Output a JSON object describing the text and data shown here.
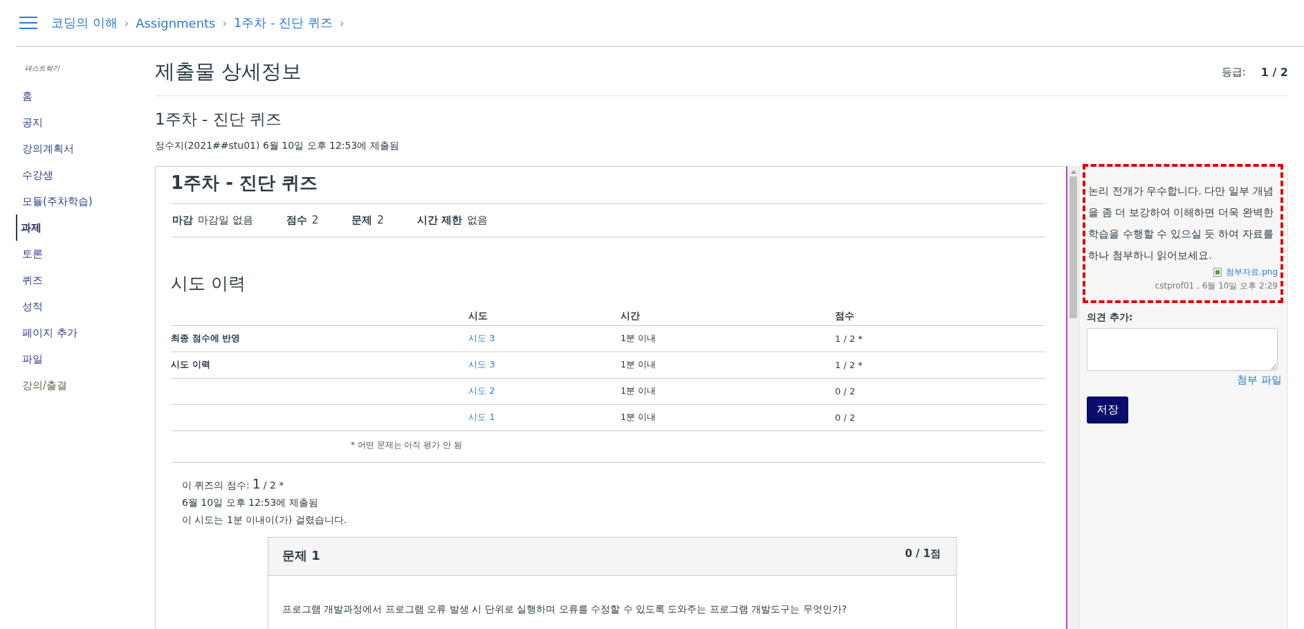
{
  "breadcrumb": {
    "separator": "›",
    "items": [
      "코딩의 이해",
      "Assignments",
      "1주차 - 진단 퀴즈"
    ]
  },
  "sidebar": {
    "term": "테스트학기",
    "items": [
      {
        "label": "홈",
        "selected": false,
        "kind": "course"
      },
      {
        "label": "공지",
        "selected": false,
        "kind": "course"
      },
      {
        "label": "강의계획서",
        "selected": false,
        "kind": "course"
      },
      {
        "label": "수강생",
        "selected": false,
        "kind": "course"
      },
      {
        "label": "모듈(주차학습)",
        "selected": false,
        "kind": "course"
      },
      {
        "label": "과제",
        "selected": true,
        "kind": "course"
      },
      {
        "label": "토론",
        "selected": false,
        "kind": "course"
      },
      {
        "label": "퀴즈",
        "selected": false,
        "kind": "course"
      },
      {
        "label": "성적",
        "selected": false,
        "kind": "course"
      },
      {
        "label": "페이지 추가",
        "selected": false,
        "kind": "course"
      },
      {
        "label": "파일",
        "selected": false,
        "kind": "course"
      },
      {
        "label": "강의/출결",
        "selected": false,
        "kind": "tool"
      }
    ]
  },
  "page": {
    "title": "제출물 상세정보",
    "grade": {
      "label": "등급:",
      "value": "1 / 2"
    },
    "subtitle": "1주차 - 진단 퀴즈",
    "submitted": "정수지(2021##stu01) 6월 10일 오후 12:53에 제출됨"
  },
  "quiz": {
    "title": "1주차 - 진단 퀴즈",
    "meta": [
      {
        "label": "마감",
        "value": "마감일 없음"
      },
      {
        "label": "점수",
        "value": "2"
      },
      {
        "label": "문제",
        "value": "2"
      },
      {
        "label": "시간 제한",
        "value": "없음"
      }
    ],
    "attempts": {
      "heading": "시도 이력",
      "columns": [
        "시도",
        "시간",
        "점수"
      ],
      "rows": [
        {
          "label": "최종 점수에 반영",
          "attempt": "시도 3",
          "time": "1분 이내",
          "score": "1 / 2 *"
        },
        {
          "label": "시도 이력",
          "attempt": "시도 3",
          "time": "1분 이내",
          "score": "1 / 2 *"
        },
        {
          "attempt": "시도 2",
          "time": "1분 이내",
          "score": "0 / 2"
        },
        {
          "attempt": "시도 1",
          "time": "1분 이내",
          "score": "0 / 2"
        }
      ],
      "footnote": "* 어떤 문제는 아직 평가 안 됨"
    },
    "summary": {
      "score_label": "이 퀴즈의 점수:",
      "score": "1",
      "score_rest": "/ 2 *",
      "submitted": "6월 10일 오후 12:53에 제출됨",
      "duration": "이 시도는 1분 이내이(가) 걸렸습니다."
    },
    "question": {
      "title": "문제 1",
      "points": "0 / 1점",
      "text": "프로그램 개발과정에서 프로그램 오류 발생 시 단위로 실행하며 오류를 수정할 수 있도록 도와주는 프로그램 개발도구는 무엇인가?"
    }
  },
  "comments": [
    {
      "text": "논리 전개가 우수합니다. 다만 일부 개념을 좀 더 보강하여 이해하면 더욱 완벽한 학습을 수행할 수 있으실 듯 하여 자료를 하나 첨부하니 읽어보세요.",
      "attachment": "첨부자료.png",
      "author": "cstprof01 , 6월 10일 오후 2:29",
      "highlighted": true
    }
  ],
  "add_comment": {
    "label": "의견 추가:",
    "attach_link": "첨부 파일",
    "save_button": "저장"
  }
}
